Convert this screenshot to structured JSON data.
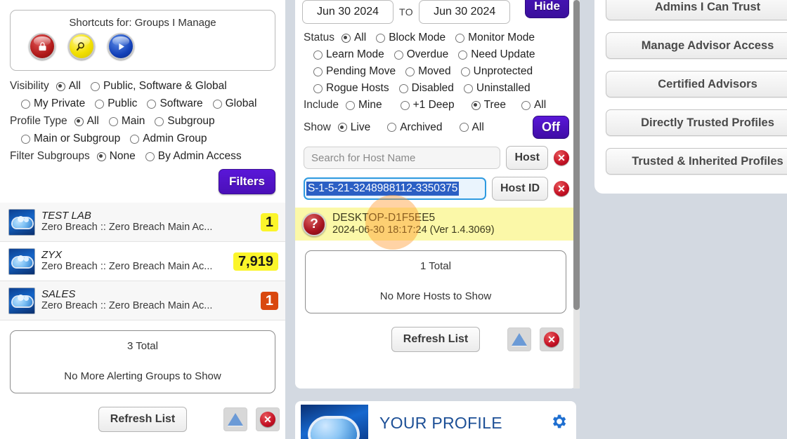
{
  "left": {
    "shortcuts": {
      "title": "Shortcuts for: Groups I Manage",
      "icons": [
        {
          "name": "lock-icon",
          "glyph": "A"
        },
        {
          "name": "magnifier-icon",
          "glyph": "Q"
        },
        {
          "name": "play-icon",
          "glyph": "▶"
        }
      ]
    },
    "visibility": {
      "label": "Visibility",
      "options": [
        {
          "label": "All",
          "selected": true
        },
        {
          "label": "Public, Software & Global",
          "selected": false
        },
        {
          "label": "My Private",
          "selected": false
        },
        {
          "label": "Public",
          "selected": false
        },
        {
          "label": "Software",
          "selected": false
        },
        {
          "label": "Global",
          "selected": false
        }
      ]
    },
    "profile_type": {
      "label": "Profile Type",
      "options": [
        {
          "label": "All",
          "selected": true
        },
        {
          "label": "Main",
          "selected": false
        },
        {
          "label": "Subgroup",
          "selected": false
        },
        {
          "label": "Main or Subgroup",
          "selected": false
        },
        {
          "label": "Admin Group",
          "selected": false
        }
      ]
    },
    "filter_subgroups": {
      "label": "Filter Subgroups",
      "options": [
        {
          "label": "None",
          "selected": true
        },
        {
          "label": "By Admin Access",
          "selected": false
        }
      ]
    },
    "filters_button": "Filters",
    "groups": [
      {
        "name": "TEST LAB",
        "path": "Zero Breach :: Zero Breach Main Ac...",
        "badge": "1",
        "badge_color": "yellow"
      },
      {
        "name": "ZYX",
        "path": "Zero Breach :: Zero Breach Main Ac...",
        "badge": "7,919",
        "badge_color": "yellow"
      },
      {
        "name": "SALES",
        "path": "Zero Breach :: Zero Breach Main Ac...",
        "badge": "1",
        "badge_color": "orange"
      }
    ],
    "total_box": {
      "total": "3 Total",
      "message": "No More Alerting Groups to Show"
    },
    "refresh_button": "Refresh List"
  },
  "middle": {
    "date_from": "Jun 30 2024",
    "date_to_label": "TO",
    "date_to": "Jun 30 2024",
    "hide_button": "Hide",
    "status": {
      "label": "Status",
      "options": [
        {
          "label": "All",
          "selected": true
        },
        {
          "label": "Block Mode",
          "selected": false
        },
        {
          "label": "Monitor Mode",
          "selected": false
        },
        {
          "label": "Learn Mode",
          "selected": false
        },
        {
          "label": "Overdue",
          "selected": false
        },
        {
          "label": "Need Update",
          "selected": false
        },
        {
          "label": "Pending Move",
          "selected": false
        },
        {
          "label": "Moved",
          "selected": false
        },
        {
          "label": "Unprotected",
          "selected": false
        },
        {
          "label": "Rogue Hosts",
          "selected": false
        },
        {
          "label": "Disabled",
          "selected": false
        },
        {
          "label": "Uninstalled",
          "selected": false
        }
      ]
    },
    "include": {
      "label": "Include",
      "options": [
        {
          "label": "Mine",
          "selected": false
        },
        {
          "label": "+1 Deep",
          "selected": false
        },
        {
          "label": "Tree",
          "selected": true
        },
        {
          "label": "All",
          "selected": false
        }
      ]
    },
    "show": {
      "label": "Show",
      "options": [
        {
          "label": "Live",
          "selected": true
        },
        {
          "label": "Archived",
          "selected": false
        },
        {
          "label": "All",
          "selected": false
        }
      ],
      "off_button": "Off"
    },
    "host_search": {
      "placeholder": "Search for Host Name",
      "value": "",
      "button": "Host"
    },
    "host_id": {
      "value": "S-1-5-21-3248988112-3350375",
      "button": "Host ID"
    },
    "host_result": {
      "name": "DESKTOP-D1F5EE5",
      "detail": "2024-06-30 18:17:24 (Ver 1.4.3069)"
    },
    "total_box": {
      "total": "1 Total",
      "message": "No More Hosts to Show"
    },
    "refresh_button": "Refresh List"
  },
  "right": {
    "buttons": [
      "Admins I Can Trust",
      "Manage Advisor Access",
      "Certified Advisors",
      "Directly Trusted Profiles",
      "Trusted & Inherited Profiles"
    ]
  },
  "profile": {
    "title": "YOUR PROFILE"
  },
  "colors": {
    "page_background": "#d3d9e1",
    "accent_purple": "#4a10b8",
    "badge_yellow": "#fbf52a",
    "badge_orange": "#d9480f",
    "host_row_yellow": "#fbf8a8",
    "selection_blue": "#2b5fc4",
    "profile_title_blue": "#1c4f96"
  }
}
